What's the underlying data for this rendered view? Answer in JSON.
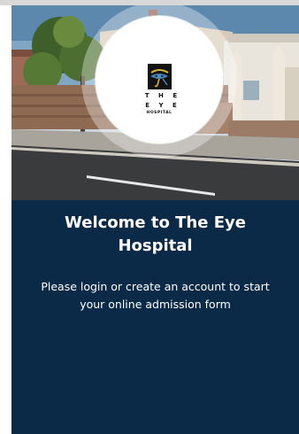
{
  "logo": {
    "line1": "T H E",
    "line2": "E Y E",
    "line3": "HOSPITAL"
  },
  "welcome": {
    "title": "Welcome to The Eye Hospital",
    "subtitle": "Please login or create an account to start your online admission form"
  },
  "colors": {
    "panel_background": "#0a2a47",
    "text": "#ffffff"
  }
}
